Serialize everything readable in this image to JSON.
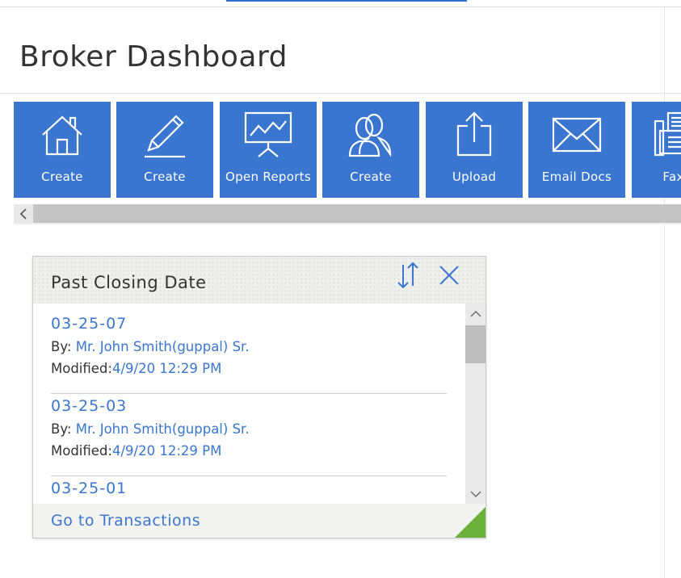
{
  "page": {
    "title": "Broker Dashboard"
  },
  "tiles": [
    {
      "label": "Create",
      "icon": "home-icon"
    },
    {
      "label": "Create",
      "icon": "pen-icon"
    },
    {
      "label": "Open Reports",
      "icon": "presentation-chart-icon"
    },
    {
      "label": "Create",
      "icon": "users-icon"
    },
    {
      "label": "Upload",
      "icon": "upload-icon"
    },
    {
      "label": "Email Docs",
      "icon": "envelope-icon"
    },
    {
      "label": "Fax D",
      "icon": "fax-icon"
    }
  ],
  "widget": {
    "title": "Past Closing Date",
    "footer_link": "Go to Transactions",
    "by_label": "By:",
    "modified_label": "Modified:",
    "items": [
      {
        "id": "03-25-07",
        "by": "Mr. John Smith(guppal) Sr.",
        "modified": "4/9/20 12:29 PM"
      },
      {
        "id": "03-25-03",
        "by": "Mr. John Smith(guppal) Sr.",
        "modified": "4/9/20 12:29 PM"
      },
      {
        "id": "03-25-01",
        "by": "",
        "modified": ""
      }
    ]
  },
  "colors": {
    "tile_blue": "#3a76cf",
    "link_blue": "#3a76cf",
    "corner_green": "#6ab23a"
  }
}
